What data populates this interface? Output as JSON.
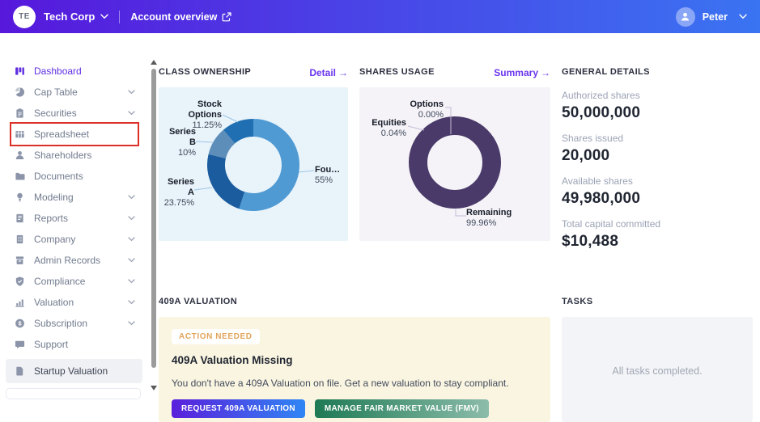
{
  "header": {
    "org_initials": "TE",
    "org_name": "Tech Corp",
    "account_link": "Account overview",
    "user_name": "Peter"
  },
  "sidebar": {
    "items": [
      {
        "label": "Dashboard",
        "icon": "dashboard-icon",
        "active": true
      },
      {
        "label": "Cap Table",
        "icon": "pie-chart-icon",
        "expandable": true
      },
      {
        "label": "Securities",
        "icon": "clipboard-icon",
        "expandable": true
      },
      {
        "label": "Spreadsheet",
        "icon": "table-icon",
        "flagged": true
      },
      {
        "label": "Shareholders",
        "icon": "person-icon"
      },
      {
        "label": "Documents",
        "icon": "folder-icon"
      },
      {
        "label": "Modeling",
        "icon": "lightbulb-icon",
        "expandable": true
      },
      {
        "label": "Reports",
        "icon": "report-icon",
        "expandable": true
      },
      {
        "label": "Company",
        "icon": "building-icon",
        "expandable": true
      },
      {
        "label": "Admin Records",
        "icon": "records-icon",
        "expandable": true
      },
      {
        "label": "Compliance",
        "icon": "shield-icon",
        "expandable": true
      },
      {
        "label": "Valuation",
        "icon": "bar-chart-icon",
        "expandable": true
      },
      {
        "label": "Subscription",
        "icon": "dollar-icon",
        "expandable": true
      },
      {
        "label": "Support",
        "icon": "chat-icon"
      },
      {
        "label": "Startup Valuation",
        "icon": "document-icon",
        "selected": true
      }
    ]
  },
  "sections": {
    "class_ownership": {
      "title": "CLASS OWNERSHIP",
      "link_label": "Detail",
      "link_arrow": "→"
    },
    "shares_usage": {
      "title": "SHARES USAGE",
      "link_label": "Summary",
      "link_arrow": "→"
    },
    "general_details": {
      "title": "GENERAL DETAILS",
      "stats": [
        {
          "label": "Authorized shares",
          "value": "50,000,000"
        },
        {
          "label": "Shares issued",
          "value": "20,000"
        },
        {
          "label": "Available shares",
          "value": "49,980,000"
        },
        {
          "label": "Total capital committed",
          "value": "$10,488"
        }
      ]
    },
    "valuation_409a": {
      "title": "409A VALUATION",
      "badge": "ACTION NEEDED",
      "heading": "409A Valuation Missing",
      "body": "You don't have a 409A Valuation on file. Get a new valuation to stay compliant.",
      "primary_button": "REQUEST 409A VALUATION",
      "secondary_button": "MANAGE FAIR MARKET VALUE (FMV)"
    },
    "tasks": {
      "title": "TASKS",
      "empty_message": "All tasks completed."
    }
  },
  "chart_data": [
    {
      "type": "pie",
      "donut": true,
      "title": "CLASS OWNERSHIP",
      "background": "#e9f3fa",
      "legend_position": "callout-labels",
      "slices": [
        {
          "label": "Fou…",
          "pct_label": "55%",
          "value": 55,
          "color": "#4f9ad3"
        },
        {
          "label": "Series A",
          "pct_label": "23.75%",
          "value": 23.75,
          "color": "#1a5c9e"
        },
        {
          "label": "Series B",
          "pct_label": "10%",
          "value": 10,
          "color": "#5d8db9"
        },
        {
          "label": "Stock Options",
          "pct_label": "11.25%",
          "value": 11.25,
          "color": "#1f6fb2"
        }
      ]
    },
    {
      "type": "pie",
      "donut": true,
      "title": "SHARES USAGE",
      "background": "#f5f3f8",
      "legend_position": "callout-labels",
      "slices": [
        {
          "label": "Options",
          "pct_label": "0.00%",
          "value": 0,
          "color": "#7a6b9b"
        },
        {
          "label": "Equities",
          "pct_label": "0.04%",
          "value": 0.04,
          "color": "#5d4d85"
        },
        {
          "label": "Remaining",
          "pct_label": "99.96%",
          "value": 99.96,
          "color": "#4a3a69"
        }
      ]
    }
  ]
}
